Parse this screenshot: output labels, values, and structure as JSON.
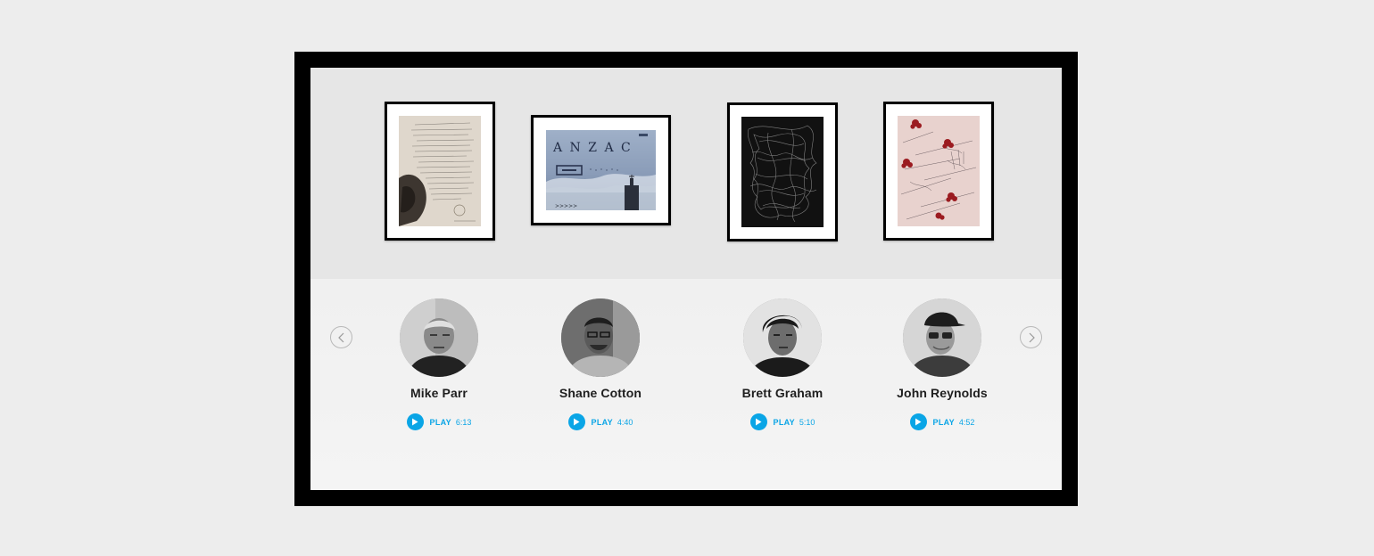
{
  "artworks": [
    {
      "icon": "manuscript-drawing-artwork",
      "inscription": ""
    },
    {
      "icon": "anzac-photo-artwork",
      "inscription": "A N Z A C"
    },
    {
      "icon": "black-scribble-artwork",
      "inscription": ""
    },
    {
      "icon": "red-flowers-artwork",
      "inscription": ""
    }
  ],
  "carousel": {
    "prev_icon": "chevron-left-icon",
    "next_icon": "chevron-right-icon"
  },
  "artists": [
    {
      "name": "Mike Parr",
      "play_label": "PLAY",
      "duration": "6:13"
    },
    {
      "name": "Shane Cotton",
      "play_label": "PLAY",
      "duration": "4:40"
    },
    {
      "name": "Brett Graham",
      "play_label": "PLAY",
      "duration": "5:10"
    },
    {
      "name": "John Reynolds",
      "play_label": "PLAY",
      "duration": "4:52"
    }
  ],
  "colors": {
    "accent": "#0aa5e6",
    "frame": "#000000",
    "wall": "#e6e6e6",
    "shelf": "#f2f2f2"
  }
}
